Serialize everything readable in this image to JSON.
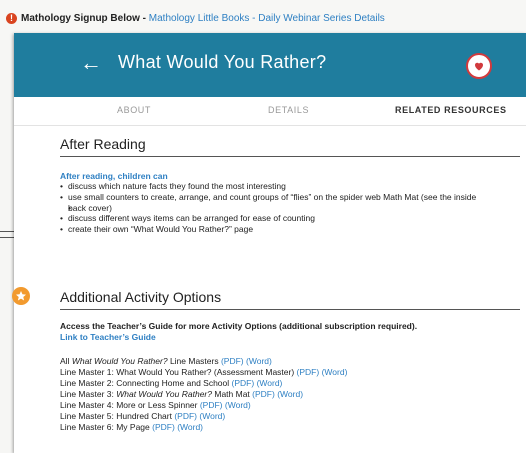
{
  "banner": {
    "prefix": "Mathology Signup Below - ",
    "link": "Mathology Little Books - Daily Webinar Series Details"
  },
  "header": {
    "title": "What Would You Rather?"
  },
  "tabs": [
    "ABOUT",
    "DETAILS",
    "RELATED RESOURCES"
  ],
  "after_reading": {
    "title": "After Reading",
    "subtitle": "After reading, children can",
    "bullets": [
      "discuss which nature facts they found the most interesting",
      "use small counters to create, arrange, and count groups of “flies” on the spider web Math Mat (see the inside",
      "back cover)",
      "discuss different ways items can be arranged for ease of counting",
      "create their own “What Would You Rather?” page"
    ]
  },
  "activity": {
    "title": "Additional Activity Options",
    "access_text": "Access the Teacher’s Guide for more Activity Options (additional subscription required).",
    "guide_link": "Link to Teacher’s Guide"
  },
  "line_masters": [
    {
      "pre": "All ",
      "italic": "What Would You Rather?",
      "post": " Line Masters ",
      "links": [
        "(PDF)",
        "(Word)"
      ]
    },
    {
      "pre": "Line Master 1: What Would You Rather? (Assessment Master) ",
      "italic": "",
      "post": "",
      "links": [
        "(PDF)",
        "(Word)"
      ]
    },
    {
      "pre": "Line Master 2: Connecting Home and School ",
      "italic": "",
      "post": "",
      "links": [
        "(PDF)",
        "(Word)"
      ]
    },
    {
      "pre": "Line Master 3: ",
      "italic": "What Would You Rather?",
      "post": " Math Mat ",
      "links": [
        "(PDF)",
        "(Word)"
      ]
    },
    {
      "pre": "Line Master 4: More or Less Spinner ",
      "italic": "",
      "post": "",
      "links": [
        "(PDF)",
        "(Word)"
      ]
    },
    {
      "pre": "Line Master 5: Hundred Chart ",
      "italic": "",
      "post": "",
      "links": [
        "(PDF)",
        "(Word)"
      ]
    },
    {
      "pre": "Line Master 6: My Page ",
      "italic": "",
      "post": "",
      "links": [
        "(PDF)",
        "(Word)"
      ]
    }
  ],
  "colors": {
    "header": "#1f7d9e",
    "link": "#2f80c3",
    "favorite": "#d13a3d",
    "star_badge": "#f29a2e",
    "warning": "#d94420"
  },
  "icons": {
    "warning": "warning-icon",
    "back": "back-arrow-icon",
    "favorite": "heart-icon",
    "star": "star-icon"
  }
}
